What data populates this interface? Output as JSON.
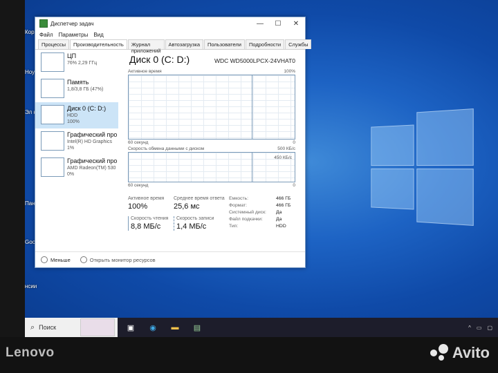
{
  "window": {
    "title": "Диспетчер задач",
    "controls": [
      "—",
      "☐",
      "✕"
    ],
    "menu": [
      "Файл",
      "Параметры",
      "Вид"
    ],
    "tabs": [
      "Процессы",
      "Производительность",
      "Журнал приложений",
      "Автозагрузка",
      "Пользователи",
      "Подробности",
      "Службы"
    ],
    "active_tab": "Производительность"
  },
  "resources": [
    {
      "name": "ЦП",
      "sub": "76% 2,29 ГГц",
      "sub2": ""
    },
    {
      "name": "Память",
      "sub": "1,8/3,8 ГБ (47%)",
      "sub2": ""
    },
    {
      "name": "Диск 0 (C: D:)",
      "sub": "HDD",
      "sub2": "100%"
    },
    {
      "name": "Графический про",
      "sub": "Intel(R) HD Graphics",
      "sub2": "1%"
    },
    {
      "name": "Графический про",
      "sub": "AMD Radeon(TM) 530",
      "sub2": "0%"
    }
  ],
  "disk": {
    "title": "Диск 0 (C: D:)",
    "model": "WDC WD5000LPCX-24VHAT0",
    "graph1": {
      "label": "Активное время",
      "max": "100%",
      "xlabel": "60 секунд",
      "xright": "0"
    },
    "graph2": {
      "label": "Скорость обмена данными с диском",
      "max": "500 КБ/с",
      "line": "450 КБ/с",
      "xlabel": "60 секунд",
      "xright": "0"
    },
    "active_time_label": "Активное время",
    "active_time": "100%",
    "resp_label": "Среднее время ответа",
    "resp": "25,6 мс",
    "read_label": "Скорость чтения",
    "read": "8,8 МБ/с",
    "write_label": "Скорость записи",
    "write": "1,4 МБ/с",
    "props": [
      {
        "k": "Емкость:",
        "v": "466 ГБ"
      },
      {
        "k": "Формат:",
        "v": "466 ГБ"
      },
      {
        "k": "Системный диск:",
        "v": "Да"
      },
      {
        "k": "Файл подкачки:",
        "v": "Да"
      },
      {
        "k": "Тип:",
        "v": "HDD"
      }
    ]
  },
  "footer": {
    "less": "Меньше",
    "monitor": "Открыть монитор ресурсов"
  },
  "taskbar": {
    "search": "Поиск"
  },
  "bezel": {
    "brand": "Lenovo",
    "watermark": "Avito"
  },
  "desktop": {
    "icons": [
      "Корз",
      "Ноу",
      "Эл комп",
      "Пан упра",
      "Goo Chr",
      "Вакансии"
    ]
  }
}
